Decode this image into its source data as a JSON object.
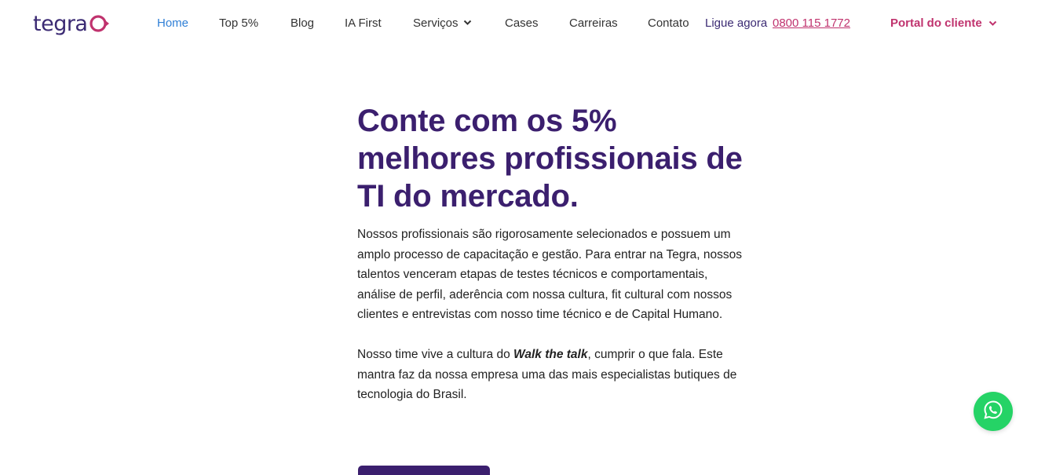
{
  "header": {
    "logo_text": "tegra",
    "nav": [
      {
        "label": "Home",
        "active": true
      },
      {
        "label": "Top 5%"
      },
      {
        "label": "Blog"
      },
      {
        "label": "IA First"
      },
      {
        "label": "Serviços",
        "has_dropdown": true
      },
      {
        "label": "Cases"
      },
      {
        "label": "Carreiras"
      },
      {
        "label": "Contato"
      }
    ],
    "phone_label": "Ligue agora",
    "phone_number": "0800 115 1772",
    "portal_label": "Portal do cliente"
  },
  "hero": {
    "title": "Conte com os 5% melhores profissionais de TI do mercado.",
    "paragraph1": "Nossos profissionais são rigorosamente selecionados e possuem um amplo processo de capacitação e gestão. Para entrar na Tegra, nossos talentos venceram etapas de testes técnicos e comportamentais, análise de perfil, aderência com nossa cultura, fit cultural com nossos clientes e entrevistas com nosso time técnico e de Capital Humano.",
    "paragraph2_before": "Nosso time vive a cultura do ",
    "paragraph2_emphasis": "Walk the talk",
    "paragraph2_after": ", cumprir o que fala. Este mantra faz da nossa empresa uma das mais especialistas butiques de tecnologia do Brasil."
  },
  "icons": {
    "logo_mark": "tegra-ring-logo-icon",
    "dropdown": "chevron-down-icon",
    "whatsapp": "whatsapp-icon"
  },
  "colors": {
    "brand_purple": "#3b1f6e",
    "brand_magenta": "#c0336e",
    "active_link": "#2f7fd6",
    "whatsapp_green": "#25d366"
  }
}
